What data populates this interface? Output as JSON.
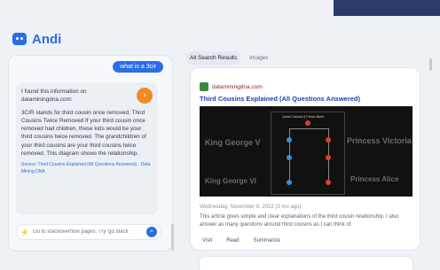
{
  "app": {
    "name": "Andi"
  },
  "chat": {
    "user_message": "what is a 3cir",
    "answer_intro": "I found this information on dataminingdna.com:",
    "answer_body": "3CIR stands for third cousin once removed. Third Cousins Twice Removed If your third cousin once removed had children, these kids would be your third cousins twice removed. The grandchildren of your third cousins are your third cousins twice removed. This diagram shows the relationship.",
    "answer_source": "Source: Third Cousins Explained (All Questions Answered) - Data Mining DNA",
    "input_placeholder": "Go to stackoverflow pages. Try 'go stack"
  },
  "results": {
    "tabs": [
      {
        "label": "All Search Results"
      },
      {
        "label": "Images"
      }
    ],
    "card": {
      "domain": "dataminingdna.com",
      "title": "Third Cousins Explained (All Questions Answered)",
      "thumb_left_top": "King George V",
      "thumb_left_bottom": "King George VI",
      "thumb_right_top": "Princess Victoria",
      "thumb_right_bottom": "Princess Alice",
      "diagram_top": "Queen Victoria & Prince Albert",
      "date": "Wednesday, November 9, 2022 (3 mo ago)",
      "description": "This article gives simple and clear explanations of the third cousin relationship. I also answer as many questions around third cousins as I can think of.",
      "actions": [
        "Visit",
        "Read",
        "Summarize"
      ]
    }
  },
  "colors": {
    "accent": "#2b6de8",
    "orange": "#f08a24"
  }
}
